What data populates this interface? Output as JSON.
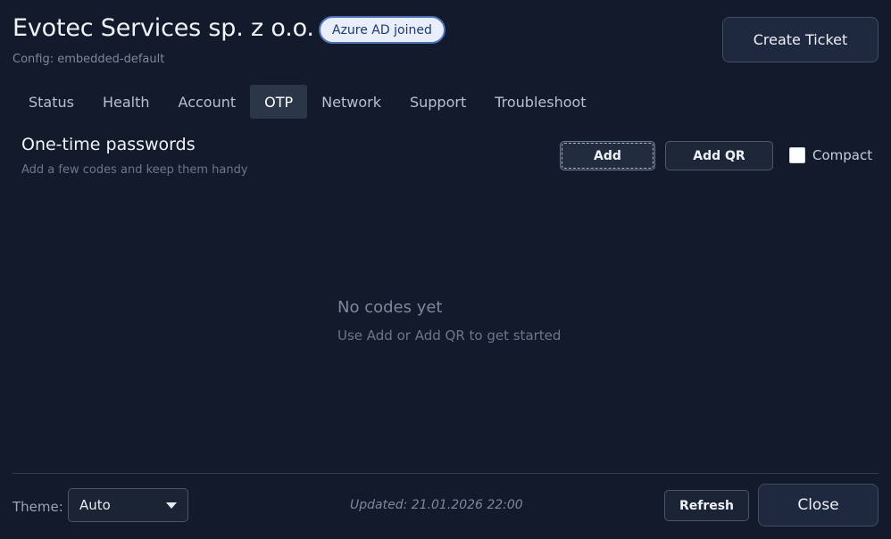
{
  "header": {
    "title": "Evotec Services sp. z o.o.",
    "badge": "Azure AD joined",
    "config": "Config: embedded-default",
    "create_ticket_label": "Create Ticket"
  },
  "tabs": [
    {
      "label": "Status"
    },
    {
      "label": "Health"
    },
    {
      "label": "Account"
    },
    {
      "label": "OTP",
      "active": true
    },
    {
      "label": "Network"
    },
    {
      "label": "Support"
    },
    {
      "label": "Troubleshoot"
    }
  ],
  "otp": {
    "title": "One-time passwords",
    "subtitle": "Add a few codes and keep them handy",
    "add_label": "Add",
    "add_qr_label": "Add QR",
    "compact_label": "Compact",
    "compact_checked": false,
    "empty_title": "No codes yet",
    "empty_subtitle": "Use Add or Add QR to get started"
  },
  "footer": {
    "theme_label": "Theme:",
    "theme_value": "Auto",
    "updated": "Updated: 21.01.2026 22:00",
    "refresh_label": "Refresh",
    "close_label": "Close"
  },
  "colors": {
    "background": "#121a2c",
    "active_tab": "#2b3749",
    "badge_bg": "#e8eefb",
    "badge_border": "#4f72b8"
  },
  "icons": {
    "theme_dropdown": "chevron-down-icon"
  }
}
